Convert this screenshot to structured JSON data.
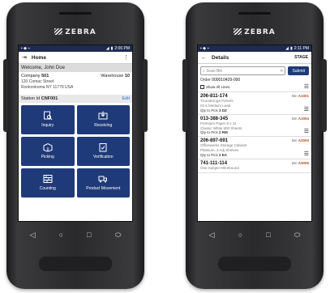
{
  "devices": [
    {
      "logo": "ZEBRA",
      "status_time": "2:06 PM",
      "appbar": {
        "title": "Home",
        "back_icon": "login-icon",
        "menu_icon": "more-vert-icon"
      },
      "welcome": "Welcome, John Doe",
      "company_label": "Company",
      "company_value": "501",
      "warehouse_label": "Warehouse",
      "warehouse_value": "10",
      "address_line1": "120 Comac Street",
      "address_line2": "Ronkonkoma NY 11779 USA",
      "station_label": "Station Id",
      "station_value": "CNF001",
      "edit_label": "Edit",
      "tiles": [
        {
          "label": "Inquiry",
          "icon": "inquiry-icon"
        },
        {
          "label": "Receiving",
          "icon": "receiving-icon"
        },
        {
          "label": "Picking",
          "icon": "picking-icon"
        },
        {
          "label": "Verification",
          "icon": "verification-icon"
        },
        {
          "label": "Counting",
          "icon": "counting-icon"
        },
        {
          "label": "Product Movement",
          "icon": "product-movement-icon"
        }
      ]
    },
    {
      "logo": "ZEBRA",
      "status_time": "2:11 PM",
      "appbar": {
        "title": "Details",
        "back_icon": "arrow-left-icon",
        "action": "STAGE"
      },
      "scan_placeholder": "Scan Bin",
      "submit_label": "Submit",
      "order_label": "Order",
      "order_value": "000010429-000",
      "show_all_label": "Show All Lines",
      "items": [
        {
          "sku": "206-811-174",
          "bin_label": "Bin",
          "bin": "A1001",
          "desc1": "Ticonderoga Pencils",
          "desc2": "#2.5 Medium Lead",
          "qty_label": "Qty to Pick",
          "qty": "3 DZ"
        },
        {
          "sku": "013-388-345",
          "bin_label": "Bin",
          "bin": "A1004",
          "desc1": "Premium Paper 8 x 11",
          "desc2": "Classic White 500 Sheets",
          "qty_label": "Qty to Pick",
          "qty": "2 RM"
        },
        {
          "sku": "206-897-691",
          "bin_label": "Bin",
          "bin": "A2000",
          "desc1": "Officeworks Storage Cabinet",
          "desc2": "Platinum, 3 Adj Shelves",
          "qty_label": "Qty to Pick",
          "qty": "2 EA"
        },
        {
          "sku": "741-111-114",
          "bin_label": "Bin",
          "bin": "A3005",
          "desc1": "One Subject Wirebound",
          "desc2": "",
          "qty_label": "",
          "qty": ""
        }
      ]
    }
  ]
}
